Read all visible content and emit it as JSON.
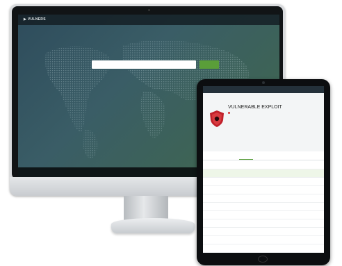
{
  "desktop": {
    "logo": "▶ VULNERS",
    "tagline": "",
    "nav": [
      "",
      ""
    ],
    "search": {
      "placeholder": "",
      "button_label": ""
    },
    "left_column": {
      "header": "",
      "links": [
        "",
        "",
        "",
        "",
        "",
        "",
        "",
        "",
        "",
        "",
        ""
      ]
    },
    "right_column": {
      "header": "",
      "links": [
        "",
        "",
        "",
        "",
        "",
        "",
        "",
        ""
      ]
    },
    "footer": "",
    "accent_color": "#5a9e39"
  },
  "tablet": {
    "logo": "",
    "breadcrumb": "",
    "title": "VULNERABLE EXPLOIT",
    "danger_line": "",
    "sub_line": "",
    "sub_line2": "",
    "severity": {
      "label": "",
      "score": ""
    },
    "facts_left": [
      "",
      "",
      ""
    ],
    "facts_right": [
      "",
      "",
      ""
    ],
    "tabs": [
      "",
      "",
      "",
      "",
      "",
      "",
      ""
    ],
    "active_tab_index": 2,
    "table": {
      "headers": [
        "",
        "",
        ""
      ],
      "rows": [
        [
          "",
          "",
          ""
        ],
        [
          "",
          "",
          ""
        ],
        [
          "",
          "",
          ""
        ],
        [
          "",
          "",
          ""
        ],
        [
          "",
          "",
          ""
        ],
        [
          "",
          "",
          ""
        ],
        [
          "",
          "",
          ""
        ],
        [
          "",
          "",
          ""
        ],
        [
          "",
          "",
          ""
        ],
        [
          "",
          "",
          ""
        ],
        [
          "",
          "",
          ""
        ]
      ]
    },
    "danger_color": "#c0202a"
  },
  "icons": {
    "shield": "shield-alert-icon",
    "camera": "camera-dot-icon",
    "home": "home-button-icon"
  }
}
